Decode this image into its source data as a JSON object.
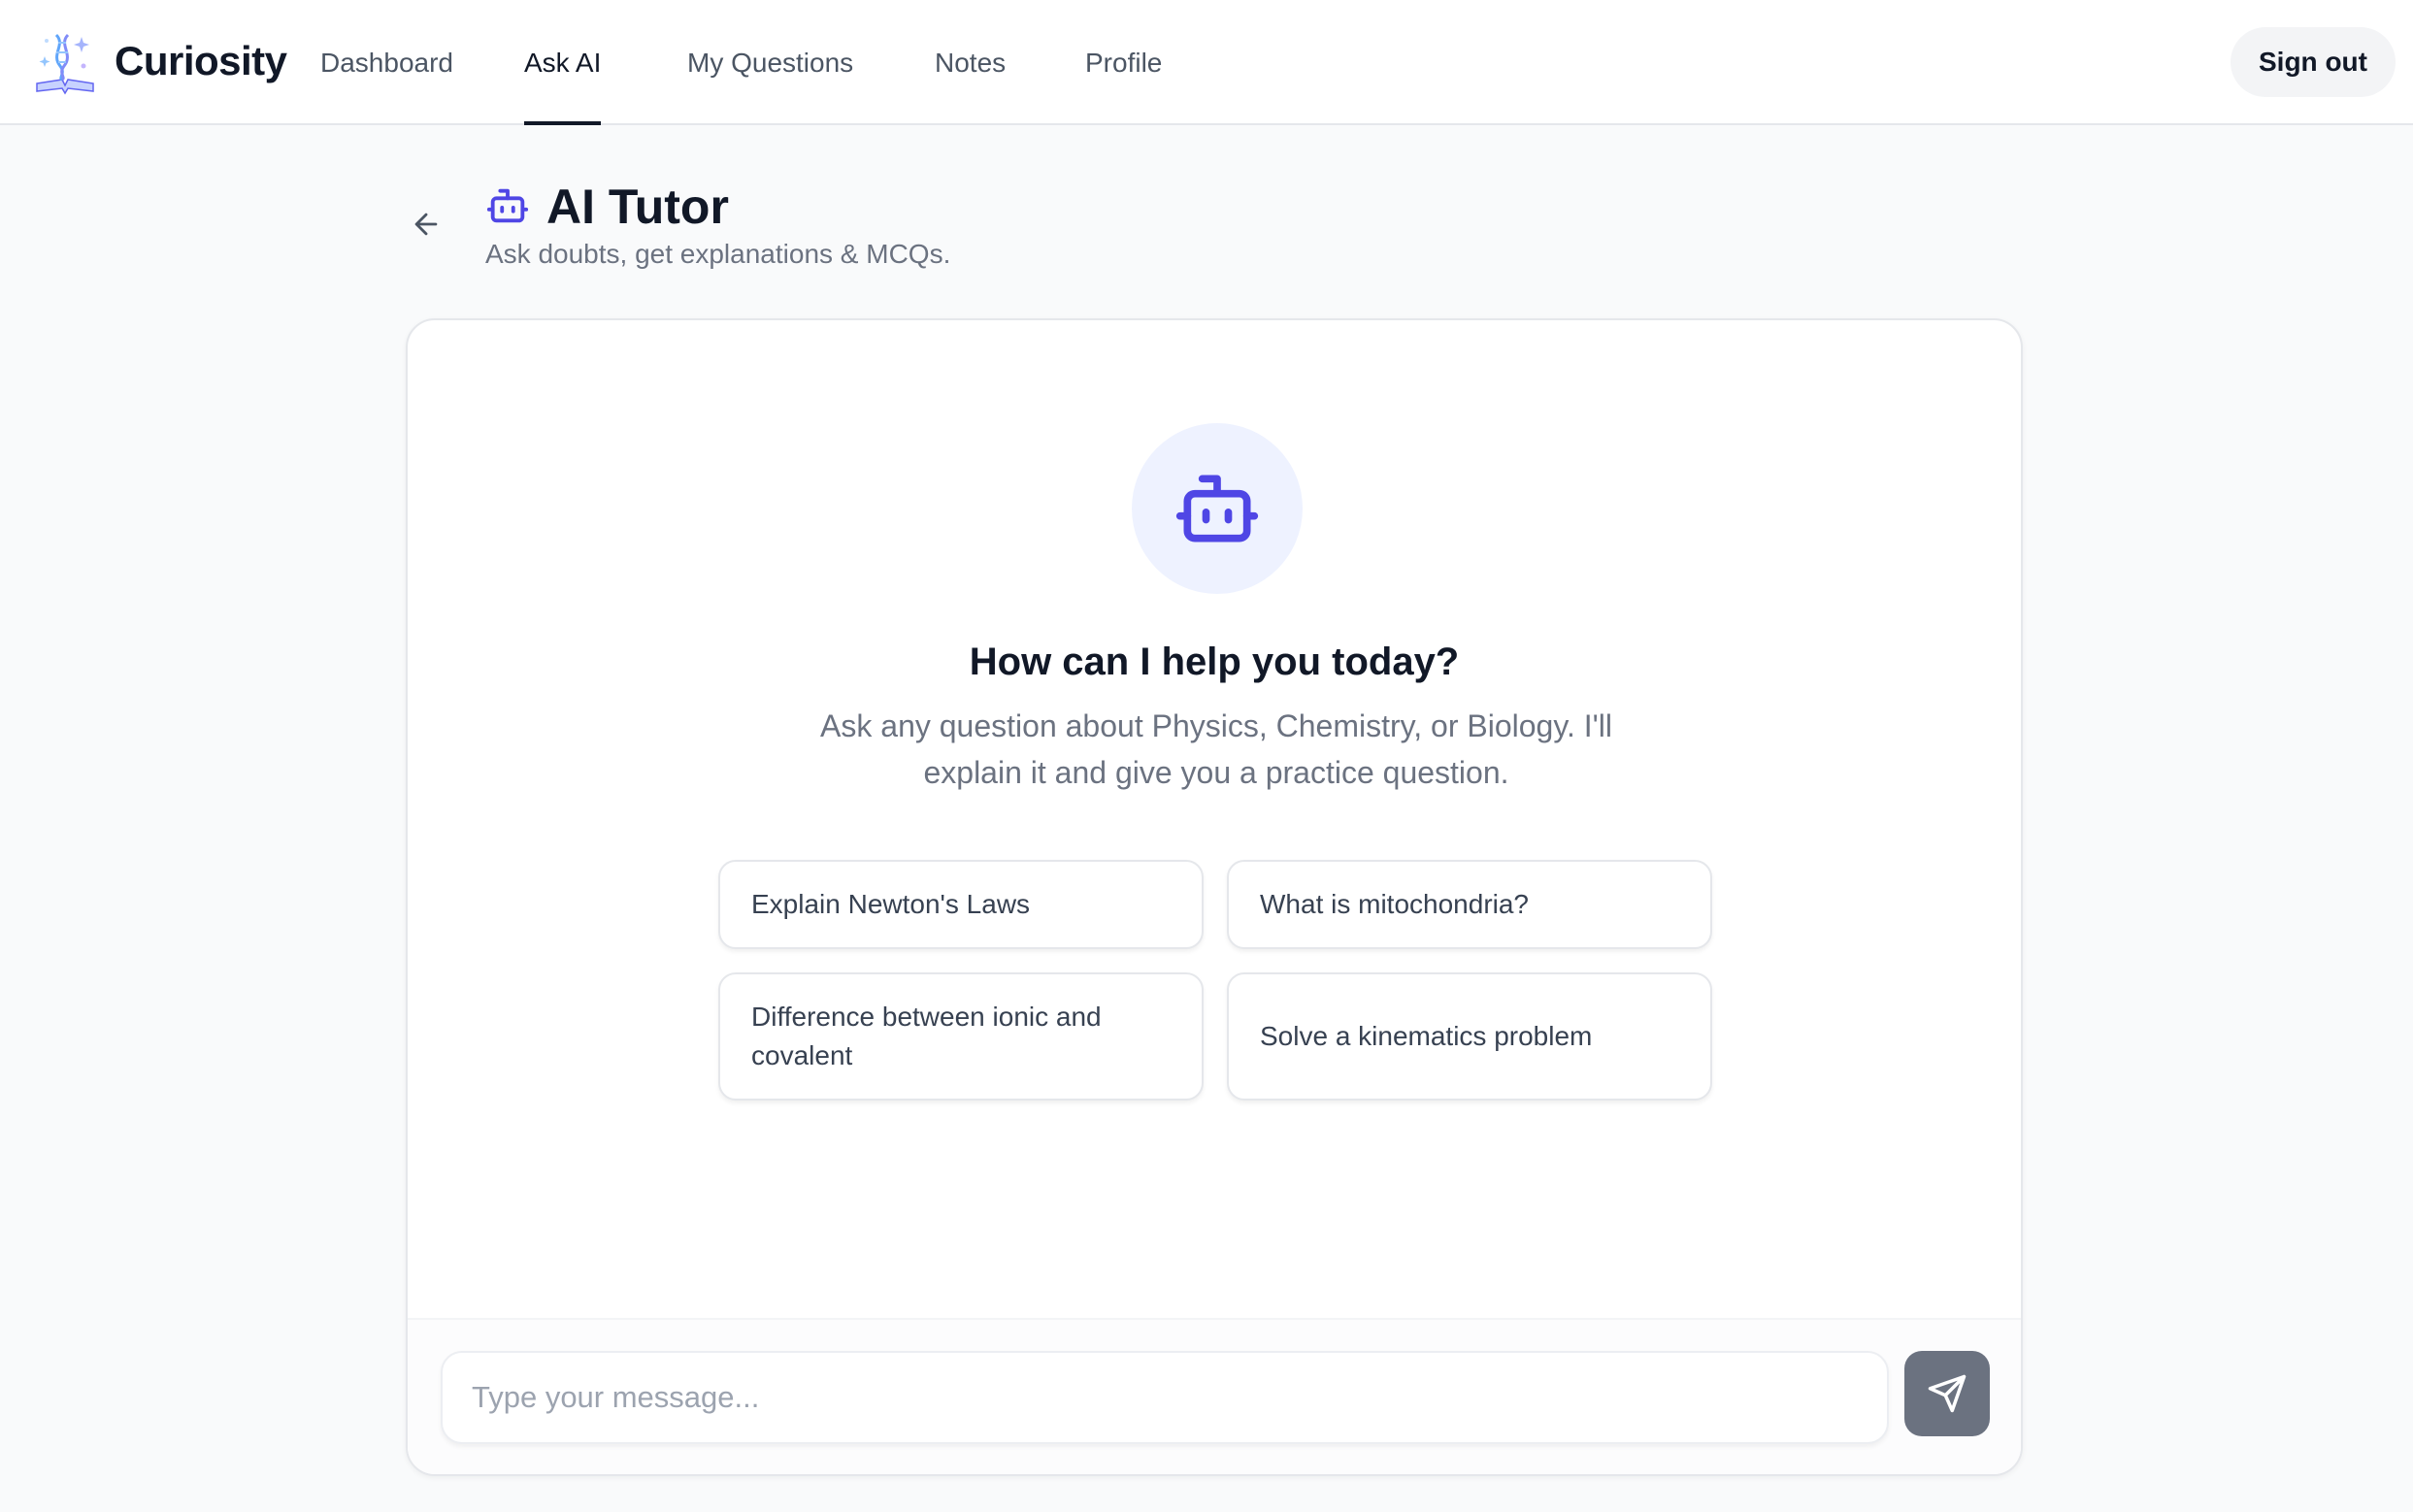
{
  "brand": {
    "name": "Curiosity",
    "logo_icon": "dna-book-logo"
  },
  "nav": {
    "items": [
      {
        "label": "Dashboard",
        "active": false
      },
      {
        "label": "Ask AI",
        "active": true
      },
      {
        "label": "My Questions",
        "active": false
      },
      {
        "label": "Notes",
        "active": false
      },
      {
        "label": "Profile",
        "active": false
      }
    ],
    "sign_out_label": "Sign out"
  },
  "header": {
    "back_icon": "arrow-left-icon",
    "title_icon": "bot-icon",
    "title": "AI Tutor",
    "subtitle": "Ask doubts, get explanations & MCQs."
  },
  "chat": {
    "welcome_icon": "bot-icon",
    "welcome_title": "How can I help you today?",
    "welcome_text": "Ask any question about Physics, Chemistry, or Biology. I'll explain it and give you a practice question.",
    "suggestions": [
      "Explain Newton's Laws",
      "What is mitochondria?",
      "Difference between ionic and covalent",
      "Solve a kinematics problem"
    ],
    "input": {
      "placeholder": "Type your message...",
      "value": ""
    },
    "send_icon": "send-icon"
  },
  "colors": {
    "accent": "#4f46e5",
    "accent_soft": "#eef2ff",
    "send_button": "#6b7280",
    "page_bg": "#f9fafb"
  }
}
